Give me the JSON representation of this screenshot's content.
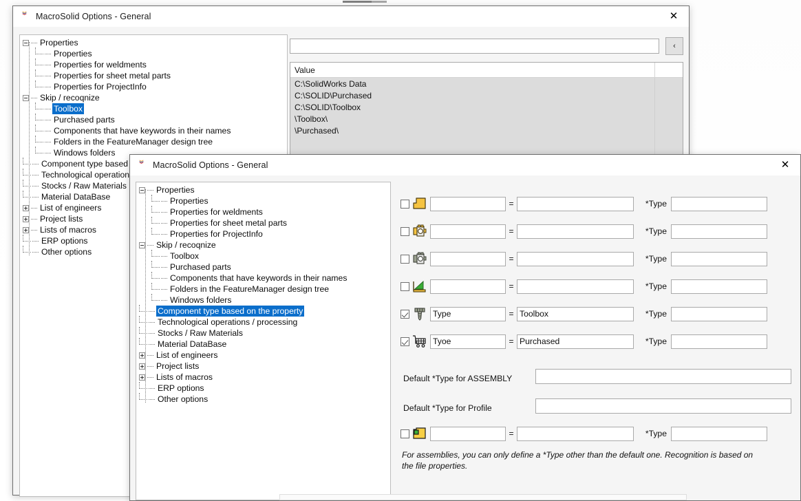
{
  "app": {
    "logo_name": "macrosolid-logo",
    "logo_colors": [
      "#f0a22e",
      "#2f4f9e",
      "#cc2222"
    ],
    "accent_selection": "#0b6ecb",
    "close_glyph": "✕"
  },
  "back_window": {
    "title": "MacroSolid Options - General",
    "tree": [
      {
        "label": "Properties",
        "level": 0,
        "toggle": "minus"
      },
      {
        "label": "Properties",
        "level": 1,
        "toggle": "none"
      },
      {
        "label": "Properties for weldments",
        "level": 1,
        "toggle": "none"
      },
      {
        "label": "Properties for sheet metal parts",
        "level": 1,
        "toggle": "none"
      },
      {
        "label": "Properties for ProjectInfo",
        "level": 1,
        "toggle": "none"
      },
      {
        "label": "Skip / recoqnize",
        "level": 0,
        "toggle": "minus"
      },
      {
        "label": "Toolbox",
        "level": 1,
        "toggle": "none",
        "selected": true
      },
      {
        "label": "Purchased parts",
        "level": 1,
        "toggle": "none"
      },
      {
        "label": "Components that have keywords in their names",
        "level": 1,
        "toggle": "none"
      },
      {
        "label": "Folders in the FeatureManager design tree",
        "level": 1,
        "toggle": "none"
      },
      {
        "label": "Windows folders",
        "level": 1,
        "toggle": "none"
      },
      {
        "label": "Component type based on the property",
        "level": 0,
        "toggle": "none"
      },
      {
        "label": "Technological operations / processing",
        "level": 0,
        "toggle": "none"
      },
      {
        "label": "Stocks / Raw Materials",
        "level": 0,
        "toggle": "none"
      },
      {
        "label": "Material DataBase",
        "level": 0,
        "toggle": "none"
      },
      {
        "label": "List of engineers",
        "level": 0,
        "toggle": "plus"
      },
      {
        "label": "Project lists",
        "level": 0,
        "toggle": "plus"
      },
      {
        "label": "Lists of macros",
        "level": 0,
        "toggle": "plus"
      },
      {
        "label": "ERP options",
        "level": 0,
        "toggle": "none"
      },
      {
        "label": "Other options",
        "level": 0,
        "toggle": "none"
      }
    ],
    "entry_value": "",
    "entry_placeholder": "",
    "back_button_label": "‹",
    "grid": {
      "columns": [
        "Value",
        ""
      ],
      "rows": [
        [
          "C:\\SolidWorks Data",
          ""
        ],
        [
          "C:\\SOLID\\Purchased",
          ""
        ],
        [
          "C:\\SOLID\\Toolbox",
          ""
        ],
        [
          "\\Toolbox\\",
          ""
        ],
        [
          "\\Purchased\\",
          ""
        ],
        [
          "",
          ""
        ],
        [
          "",
          ""
        ]
      ]
    }
  },
  "front_window": {
    "title": "MacroSolid Options - General",
    "tree": [
      {
        "label": "Properties",
        "level": 0,
        "toggle": "minus"
      },
      {
        "label": "Properties",
        "level": 1,
        "toggle": "none"
      },
      {
        "label": "Properties for weldments",
        "level": 1,
        "toggle": "none"
      },
      {
        "label": "Properties for sheet metal parts",
        "level": 1,
        "toggle": "none"
      },
      {
        "label": "Properties for ProjectInfo",
        "level": 1,
        "toggle": "none"
      },
      {
        "label": "Skip / recoqnize",
        "level": 0,
        "toggle": "minus"
      },
      {
        "label": "Toolbox",
        "level": 1,
        "toggle": "none"
      },
      {
        "label": "Purchased parts",
        "level": 1,
        "toggle": "none"
      },
      {
        "label": "Components that have keywords in their names",
        "level": 1,
        "toggle": "none"
      },
      {
        "label": "Folders in the FeatureManager design tree",
        "level": 1,
        "toggle": "none"
      },
      {
        "label": "Windows folders",
        "level": 1,
        "toggle": "none"
      },
      {
        "label": "Component type based on the property",
        "level": 0,
        "toggle": "none",
        "selected": true
      },
      {
        "label": "Technological operations / processing",
        "level": 0,
        "toggle": "none"
      },
      {
        "label": "Stocks / Raw Materials",
        "level": 0,
        "toggle": "none"
      },
      {
        "label": "Material DataBase",
        "level": 0,
        "toggle": "none"
      },
      {
        "label": "List of engineers",
        "level": 0,
        "toggle": "plus"
      },
      {
        "label": "Project lists",
        "level": 0,
        "toggle": "plus"
      },
      {
        "label": "Lists of macros",
        "level": 0,
        "toggle": "plus"
      },
      {
        "label": "ERP options",
        "level": 0,
        "toggle": "none"
      },
      {
        "label": "Other options",
        "level": 0,
        "toggle": "none"
      }
    ],
    "equals_symbol": "=",
    "type_label": "*Type",
    "rows": [
      {
        "icon": "part-yellow-icon",
        "checked": false,
        "property": "",
        "value": "",
        "type": ""
      },
      {
        "icon": "assembly-yellow-icon",
        "checked": false,
        "property": "",
        "value": "",
        "type": ""
      },
      {
        "icon": "assembly-gray-icon",
        "checked": false,
        "property": "",
        "value": "",
        "type": ""
      },
      {
        "icon": "sheetmetal-icon",
        "checked": false,
        "property": "",
        "value": "",
        "type": ""
      },
      {
        "icon": "bolt-icon",
        "checked": true,
        "property": "Type",
        "value": "Toolbox",
        "type": ""
      },
      {
        "icon": "cart-icon",
        "checked": true,
        "property": "Tyoe",
        "value": "Purchased",
        "type": ""
      }
    ],
    "default_assembly_label": "Default *Type for ASSEMBLY",
    "default_assembly_value": "",
    "default_profile_label": "Default *Type for Profile",
    "default_profile_value": "",
    "assembly_row": {
      "icon": "assembly-green-yellow-icon",
      "checked": false,
      "property": "",
      "value": "",
      "type": ""
    },
    "note": "For assemblies, you can only define a *Type other than the default one. Recognition is based on the file properties."
  }
}
